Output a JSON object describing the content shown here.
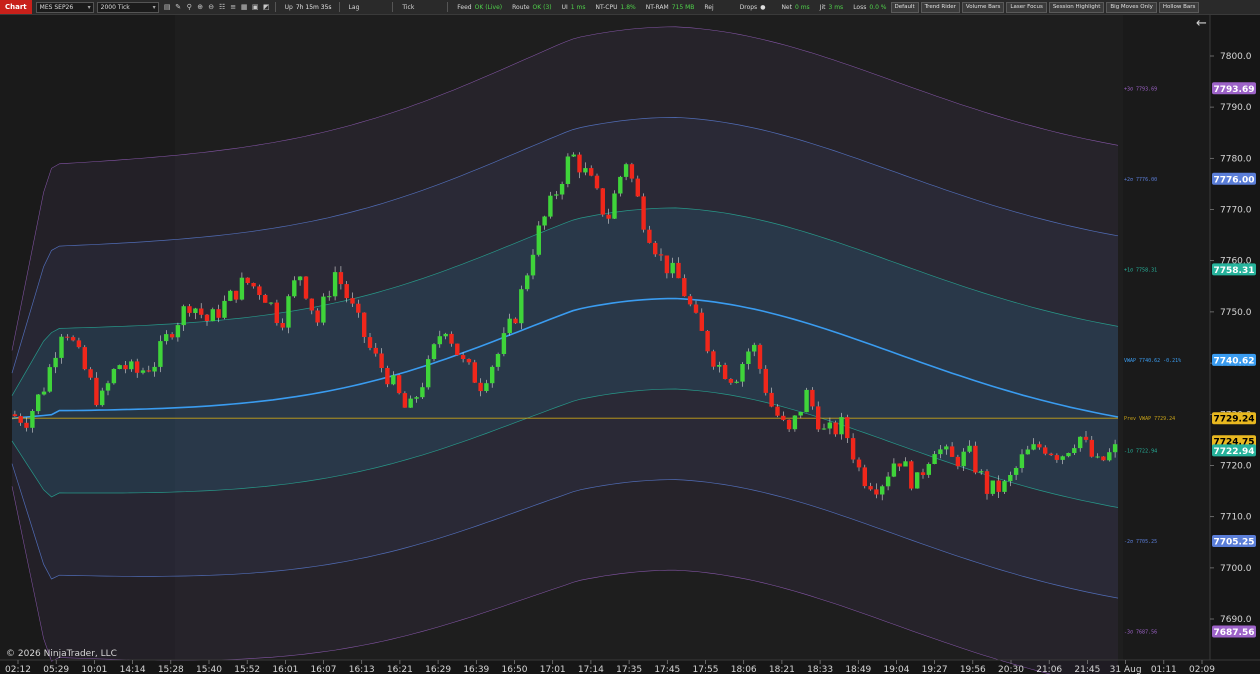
{
  "toolbar": {
    "chart_tab": "Chart",
    "instrument": "MES SEP26",
    "period": "2000 Tick",
    "up_label": "Up",
    "up_value": "7h 15m 35s",
    "lag_label": "Lag",
    "tick_label": "Tick",
    "feed_label": "Feed",
    "feed_value": "OK (Live)",
    "route_label": "Route",
    "route_value": "OK (3)",
    "ui_label": "UI",
    "ui_value": "1 ms",
    "ntcpu_label": "NT-CPU",
    "ntcpu_value": "1.8%",
    "ntram_label": "NT-RAM",
    "ntram_value": "715 MB",
    "rej_label": "Rej",
    "drops_label": "Drops",
    "net_label": "Net",
    "net_value": "0 ms",
    "jit_label": "Jit",
    "jit_value": "3 ms",
    "loss_label": "Loss",
    "loss_value": "0.0 %",
    "buttons": [
      "Default",
      "Trend Rider",
      "Volume Bars",
      "Laser Focus",
      "Session Highlight",
      "Big Moves Only",
      "Hollow Bars"
    ]
  },
  "copyright": "© 2026 NinjaTrader, LLC",
  "back_icon": "arrow-left-icon",
  "colors": {
    "up_bar": "#3fd43a",
    "down_bar": "#f0271b",
    "vwap": "#3a9cf0",
    "band1": "#27b39c",
    "band2": "#5b7ed8",
    "band3": "#9d63c8",
    "prev_vwap": "#c9a318"
  },
  "chart_data": {
    "type": "candlestick",
    "instrument": "MES SEP26",
    "period": "2000 Tick",
    "y_range": [
      7682,
      7808
    ],
    "y_ticks": [
      7800,
      7790,
      7780,
      7770,
      7760,
      7750,
      7740,
      7730,
      7720,
      7710,
      7700,
      7690
    ],
    "x_ticks": [
      "02:12",
      "05:29",
      "10:01",
      "14:14",
      "15:28",
      "15:40",
      "15:52",
      "16:01",
      "16:07",
      "16:13",
      "16:21",
      "16:29",
      "16:39",
      "16:50",
      "17:01",
      "17:14",
      "17:35",
      "17:45",
      "17:55",
      "18:06",
      "18:21",
      "18:33",
      "18:49",
      "19:04",
      "19:27",
      "19:56",
      "20:30",
      "21:06",
      "21:45",
      "31 Aug",
      "01:11",
      "02:09"
    ],
    "close_path": [
      7730,
      7729,
      7736,
      7748,
      7740,
      7732,
      7740,
      7738,
      7740,
      7747,
      7752,
      7748,
      7752,
      7756,
      7754,
      7748,
      7758,
      7748,
      7758,
      7750,
      7742,
      7737,
      7730,
      7738,
      7748,
      7740,
      7736,
      7742,
      7750,
      7764,
      7772,
      7781,
      7776,
      7768,
      7780,
      7768,
      7760,
      7756,
      7747,
      7740,
      7737,
      7744,
      7732,
      7726,
      7734,
      7726,
      7728,
      7718,
      7716,
      7722,
      7716,
      7724,
      7721,
      7722,
      7715,
      7716,
      7722,
      7724,
      7722,
      7726,
      7720,
      7723
    ],
    "bands": [
      {
        "name": "+3σ",
        "value": 7793.69,
        "label": "+3σ  7793.69"
      },
      {
        "name": "+2σ",
        "value": 7776.0,
        "label": "+2σ  7776.00"
      },
      {
        "name": "+1σ",
        "value": 7758.31,
        "label": "+1σ  7758.31"
      },
      {
        "name": "VWAP",
        "value": 7740.62,
        "label": "VWAP  7740.62  -0.21%"
      },
      {
        "name": "-1σ",
        "value": 7722.94,
        "label": "-1σ  7722.94"
      },
      {
        "name": "-2σ",
        "value": 7705.25,
        "label": "-2σ  7705.25"
      },
      {
        "name": "-3σ",
        "value": 7687.56,
        "label": "-3σ  7687.56"
      }
    ],
    "prev_vwap": {
      "name": "Prev VWAP",
      "value": 7729.24,
      "label": "Prev VWAP  7729.24"
    },
    "last_price": 7724.75,
    "price_tags": [
      {
        "value": 7793.69,
        "text": "7793.69",
        "bg": "#9d63c8",
        "fg": "#ffffff"
      },
      {
        "value": 7776.0,
        "text": "7776.00",
        "bg": "#5b7ed8",
        "fg": "#ffffff"
      },
      {
        "value": 7758.31,
        "text": "7758.31",
        "bg": "#27b39c",
        "fg": "#ffffff"
      },
      {
        "value": 7740.62,
        "text": "7740.62",
        "bg": "#3a9cf0",
        "fg": "#ffffff"
      },
      {
        "value": 7729.24,
        "text": "7729.24",
        "bg": "#e8b820",
        "fg": "#000000"
      },
      {
        "value": 7724.75,
        "text": "7724.75",
        "bg": "#e8b820",
        "fg": "#000000"
      },
      {
        "value": 7722.94,
        "text": "7722.94",
        "bg": "#27b39c",
        "fg": "#ffffff"
      },
      {
        "value": 7705.25,
        "text": "7705.25",
        "bg": "#5b7ed8",
        "fg": "#ffffff"
      },
      {
        "value": 7687.56,
        "text": "7687.56",
        "bg": "#9d63c8",
        "fg": "#ffffff"
      }
    ]
  }
}
